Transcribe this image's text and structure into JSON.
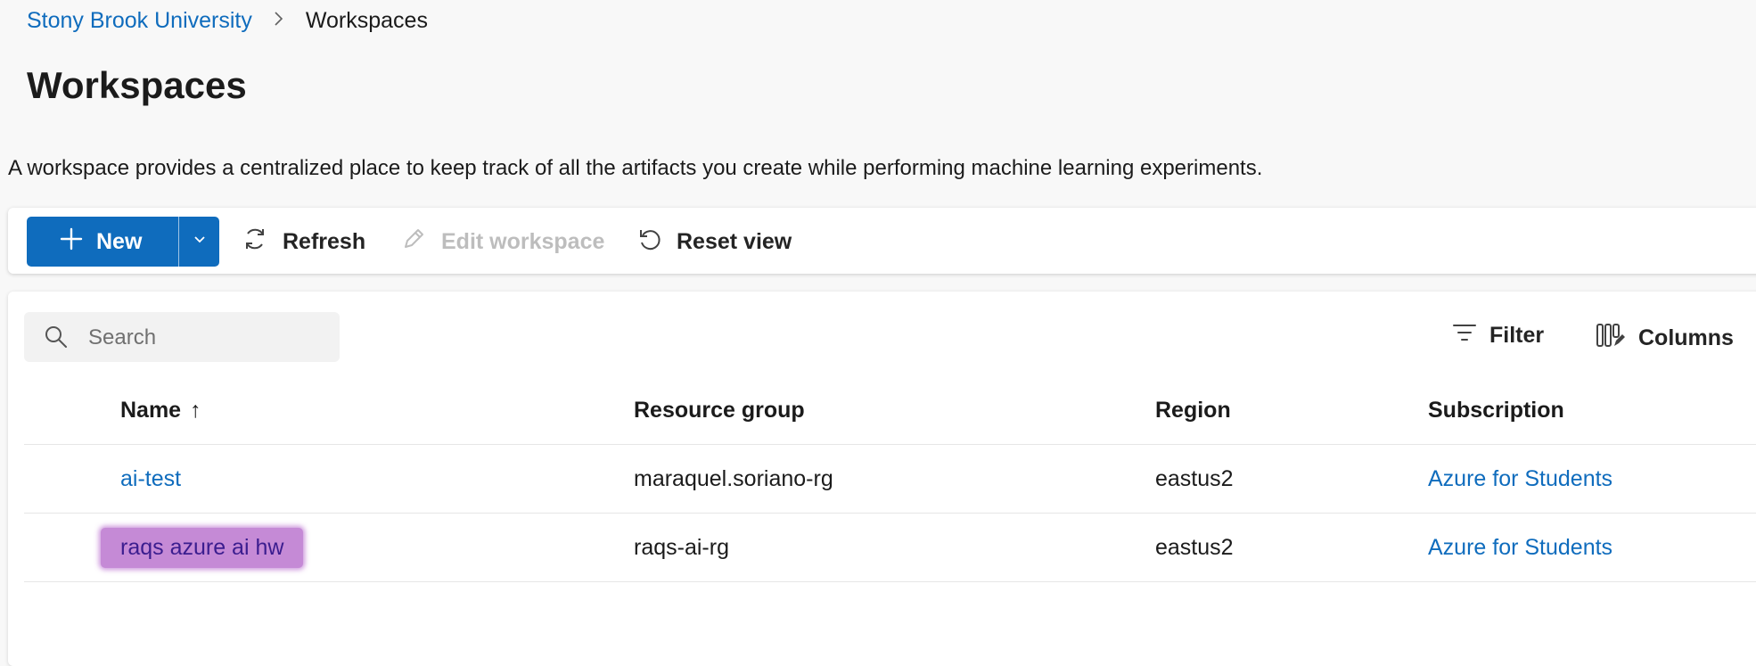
{
  "breadcrumb": {
    "root": "Stony Brook University",
    "separator": ">",
    "current": "Workspaces"
  },
  "page": {
    "title": "Workspaces",
    "description": "A workspace provides a centralized place to keep track of all the artifacts you create while performing machine learning experiments."
  },
  "toolbar": {
    "new_label": "New",
    "refresh_label": "Refresh",
    "edit_label": "Edit workspace",
    "reset_label": "Reset view"
  },
  "search": {
    "placeholder": "Search"
  },
  "tools": {
    "filter_label": "Filter",
    "columns_label": "Columns"
  },
  "table": {
    "headers": {
      "name": "Name",
      "sort_indicator": "↑",
      "resource_group": "Resource group",
      "region": "Region",
      "subscription": "Subscription"
    },
    "rows": [
      {
        "name": "ai-test",
        "resource_group": "maraquel.soriano-rg",
        "region": "eastus2",
        "subscription": "Azure for Students"
      },
      {
        "name": "raqs azure ai hw",
        "resource_group": "raqs-ai-rg",
        "region": "eastus2",
        "subscription": "Azure for Students"
      }
    ]
  },
  "colors": {
    "accent": "#0f6cbd",
    "highlight": "#c58ad6"
  }
}
